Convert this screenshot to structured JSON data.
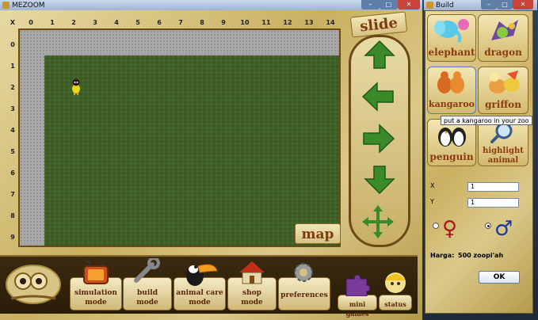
{
  "main_window": {
    "title": "MEZOOM",
    "slide_label": "slide",
    "map_label": "map",
    "x_axis_label": "X",
    "x_ticks": [
      "0",
      "1",
      "2",
      "3",
      "4",
      "5",
      "6",
      "7",
      "8",
      "9",
      "10",
      "11",
      "12",
      "13",
      "14"
    ],
    "y_ticks": [
      "0",
      "1",
      "2",
      "3",
      "4",
      "5",
      "6",
      "7",
      "8",
      "9"
    ],
    "zoo_map": {
      "animal_cell_x": 2,
      "animal_cell_y": 2
    },
    "bottom_menu": [
      {
        "line1": "simulation",
        "line2": "mode"
      },
      {
        "line1": "build",
        "line2": "mode"
      },
      {
        "line1": "animal care",
        "line2": "mode"
      },
      {
        "line1": "shop",
        "line2": "mode"
      },
      {
        "line1": "preferences",
        "line2": ""
      },
      {
        "line1": "mini games",
        "line2": ""
      },
      {
        "line1": "status",
        "line2": ""
      }
    ]
  },
  "build_window": {
    "title": "Build",
    "animals": [
      {
        "line1": "elephant",
        "line2": ""
      },
      {
        "line1": "dragon",
        "line2": ""
      },
      {
        "line1": "kangaroo",
        "line2": ""
      },
      {
        "line1": "griffon",
        "line2": ""
      },
      {
        "line1": "penguin",
        "line2": ""
      },
      {
        "line1": "highlight",
        "line2": "animal"
      }
    ],
    "tooltip": "put a kangaroo in your zoo",
    "x_label": "X",
    "x_value": "1",
    "y_label": "Y",
    "y_value": "1",
    "female_symbol": "♀",
    "male_symbol": "♂",
    "price_label": "Harga:",
    "price_value": "500 zoopi'ah",
    "ok_label": "OK"
  }
}
